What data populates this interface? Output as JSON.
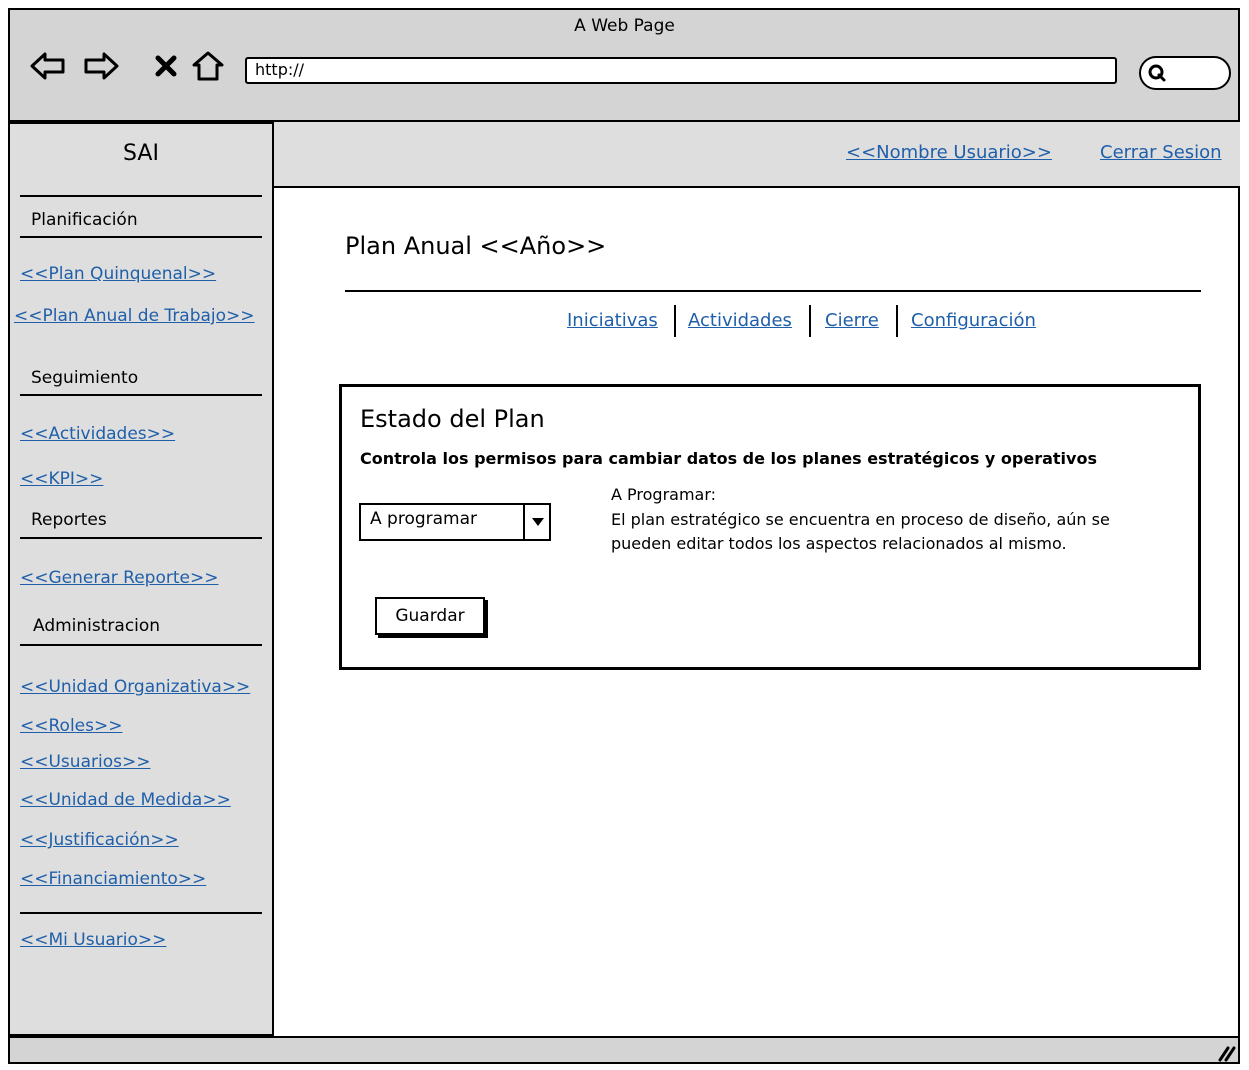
{
  "browser": {
    "window_title": "A Web Page",
    "url": "http://",
    "icons": [
      "back-icon",
      "forward-icon",
      "stop-icon",
      "home-icon",
      "search-icon",
      "resize-grip-icon"
    ]
  },
  "sidebar": {
    "brand": "SAI",
    "sections": {
      "planificacion": "Planificación",
      "seguimiento": "Seguimiento",
      "reportes": "Reportes",
      "administracion": "Administracion"
    },
    "links": {
      "plan_quinquenal": "<<Plan Quinquenal>>",
      "plan_anual": "<<Plan Anual de Trabajo>>",
      "actividades": "<<Actividades>>",
      "kpi": "<<KPI>>",
      "generar_reporte": "<<Generar Reporte>>",
      "unidad_organizativa": "<<Unidad Organizativa>>",
      "roles": "<<Roles>>",
      "usuarios": "<<Usuarios>>",
      "unidad_medida": "<<Unidad de Medida>>",
      "justificacion": "<<Justificación>>",
      "financiamiento": "<<Financiamiento>>",
      "mi_usuario": "<<Mi Usuario>>"
    }
  },
  "header": {
    "user_name": "<<Nombre Usuario>>",
    "logout": "Cerrar Sesion"
  },
  "main": {
    "title": "Plan Anual <<Año>>",
    "tabs": [
      "Iniciativas",
      "Actividades",
      "Cierre",
      "Configuración"
    ],
    "panel": {
      "title": "Estado del Plan",
      "subtitle": "Controla los permisos para cambiar datos de los planes estratégicos y operativos",
      "status_selected": "A programar",
      "status_heading": "A Programar:",
      "status_description": "El plan estratégico se encuentra en proceso de diseño, aún se pueden editar todos los aspectos relacionados al mismo.",
      "save_label": "Guardar"
    }
  },
  "colors": {
    "link": "#1f5fa9",
    "chrome": "#d4d4d4",
    "sidebar_bg": "#dedede"
  }
}
